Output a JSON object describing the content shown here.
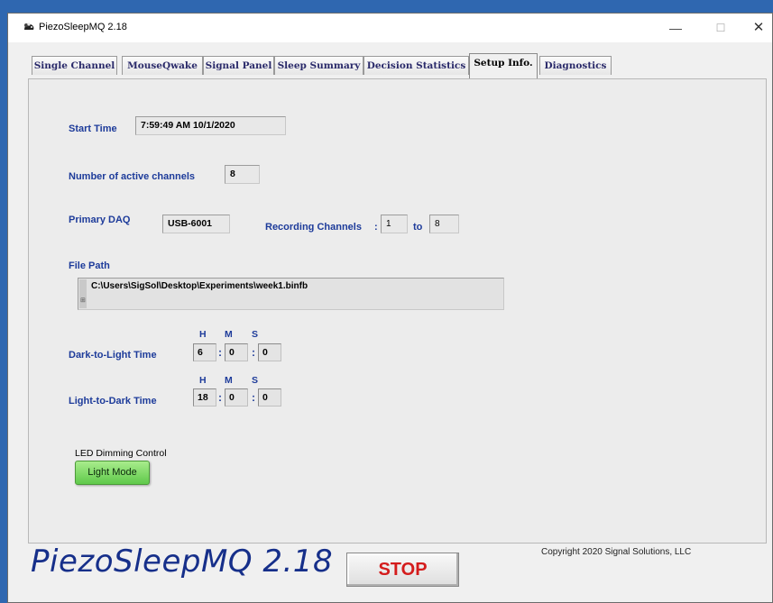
{
  "window": {
    "title": "PiezoSleepMQ 2.18",
    "controls": {
      "minimize": "—",
      "maximize": "☐",
      "close": "✕"
    }
  },
  "tabs": [
    {
      "label": "Single Channel"
    },
    {
      "label": "MouseQwake"
    },
    {
      "label": "Signal Panel"
    },
    {
      "label": "Sleep Summary"
    },
    {
      "label": "Decision Statistics"
    },
    {
      "label": "Setup Info."
    },
    {
      "label": "Diagnostics"
    }
  ],
  "active_tab": "Setup Info.",
  "setup": {
    "start_time_label": "Start Time",
    "start_time_value": "7:59:49 AM 10/1/2020",
    "active_channels_label": "Number of active channels",
    "active_channels_value": "8",
    "primary_daq_label": "Primary DAQ",
    "primary_daq_value": "USB-6001",
    "recording_channels_label": "Recording Channels",
    "recording_colon": ":",
    "recording_from": "1",
    "recording_to_label": "to",
    "recording_to": "8",
    "file_path_label": "File Path",
    "file_path_value": "C:\\Users\\SigSol\\Desktop\\Experiments\\week1.binfb",
    "hms_labels": {
      "h": "H",
      "m": "M",
      "s": "S"
    },
    "dark_to_light_label": "Dark-to-Light Time",
    "dark_to_light": {
      "h": "6",
      "m": "0",
      "s": "0"
    },
    "light_to_dark_label": "Light-to-Dark Time",
    "light_to_dark": {
      "h": "18",
      "m": "0",
      "s": "0"
    },
    "time_colon": ":",
    "led_label": "LED Dimming Control",
    "light_mode_button": "Light Mode"
  },
  "footer": {
    "brand": "PiezoSleepMQ 2.18",
    "stop_button": "STOP",
    "copyright": "Copyright 2020 Signal Solutions, LLC"
  },
  "colors": {
    "label_blue": "#1d3b9a",
    "brand_blue": "#162f8a",
    "stop_red": "#d41c1c",
    "light_mode_green": "#5fc94a",
    "desktop_blue": "#2f67b0"
  },
  "icons": {
    "app": "mouse-app-icon",
    "file_path": "file-path-marker-icon"
  }
}
